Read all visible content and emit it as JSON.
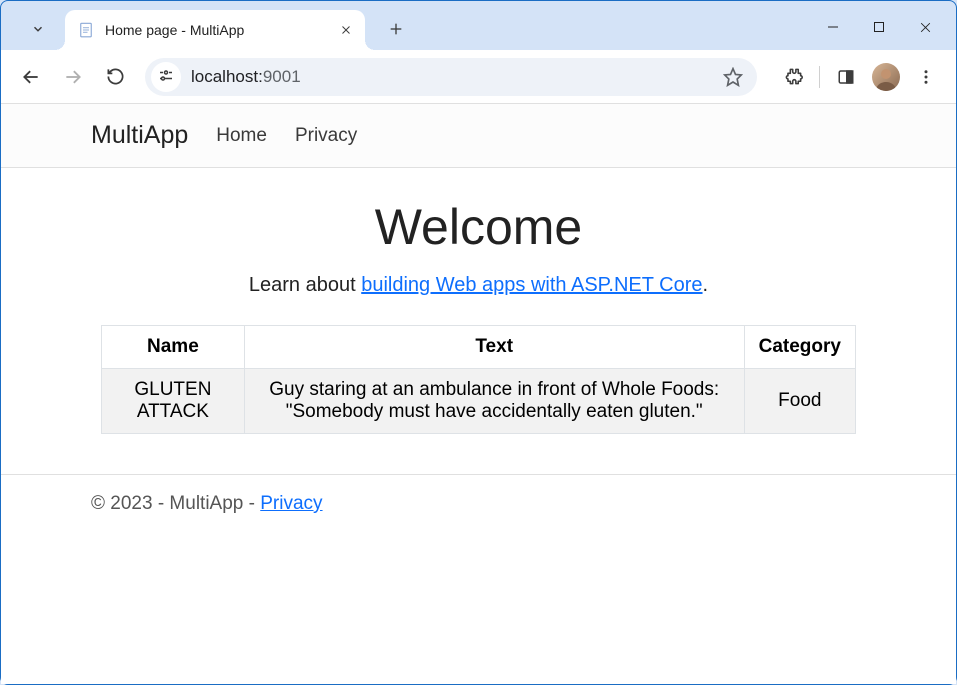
{
  "browser": {
    "tab_title": "Home page - MultiApp",
    "url_prefix": "localhost:",
    "url_port": "9001"
  },
  "nav": {
    "brand": "MultiApp",
    "links": [
      "Home",
      "Privacy"
    ]
  },
  "hero": {
    "title": "Welcome",
    "lead_prefix": "Learn about ",
    "lead_link": "building Web apps with ASP.NET Core",
    "lead_suffix": "."
  },
  "table": {
    "headers": [
      "Name",
      "Text",
      "Category"
    ],
    "rows": [
      {
        "name": "GLUTEN ATTACK",
        "text": "Guy staring at an ambulance in front of Whole Foods: \"Somebody must have accidentally eaten gluten.\"",
        "category": "Food"
      }
    ]
  },
  "footer": {
    "text": "© 2023 - MultiApp - ",
    "link": "Privacy"
  }
}
